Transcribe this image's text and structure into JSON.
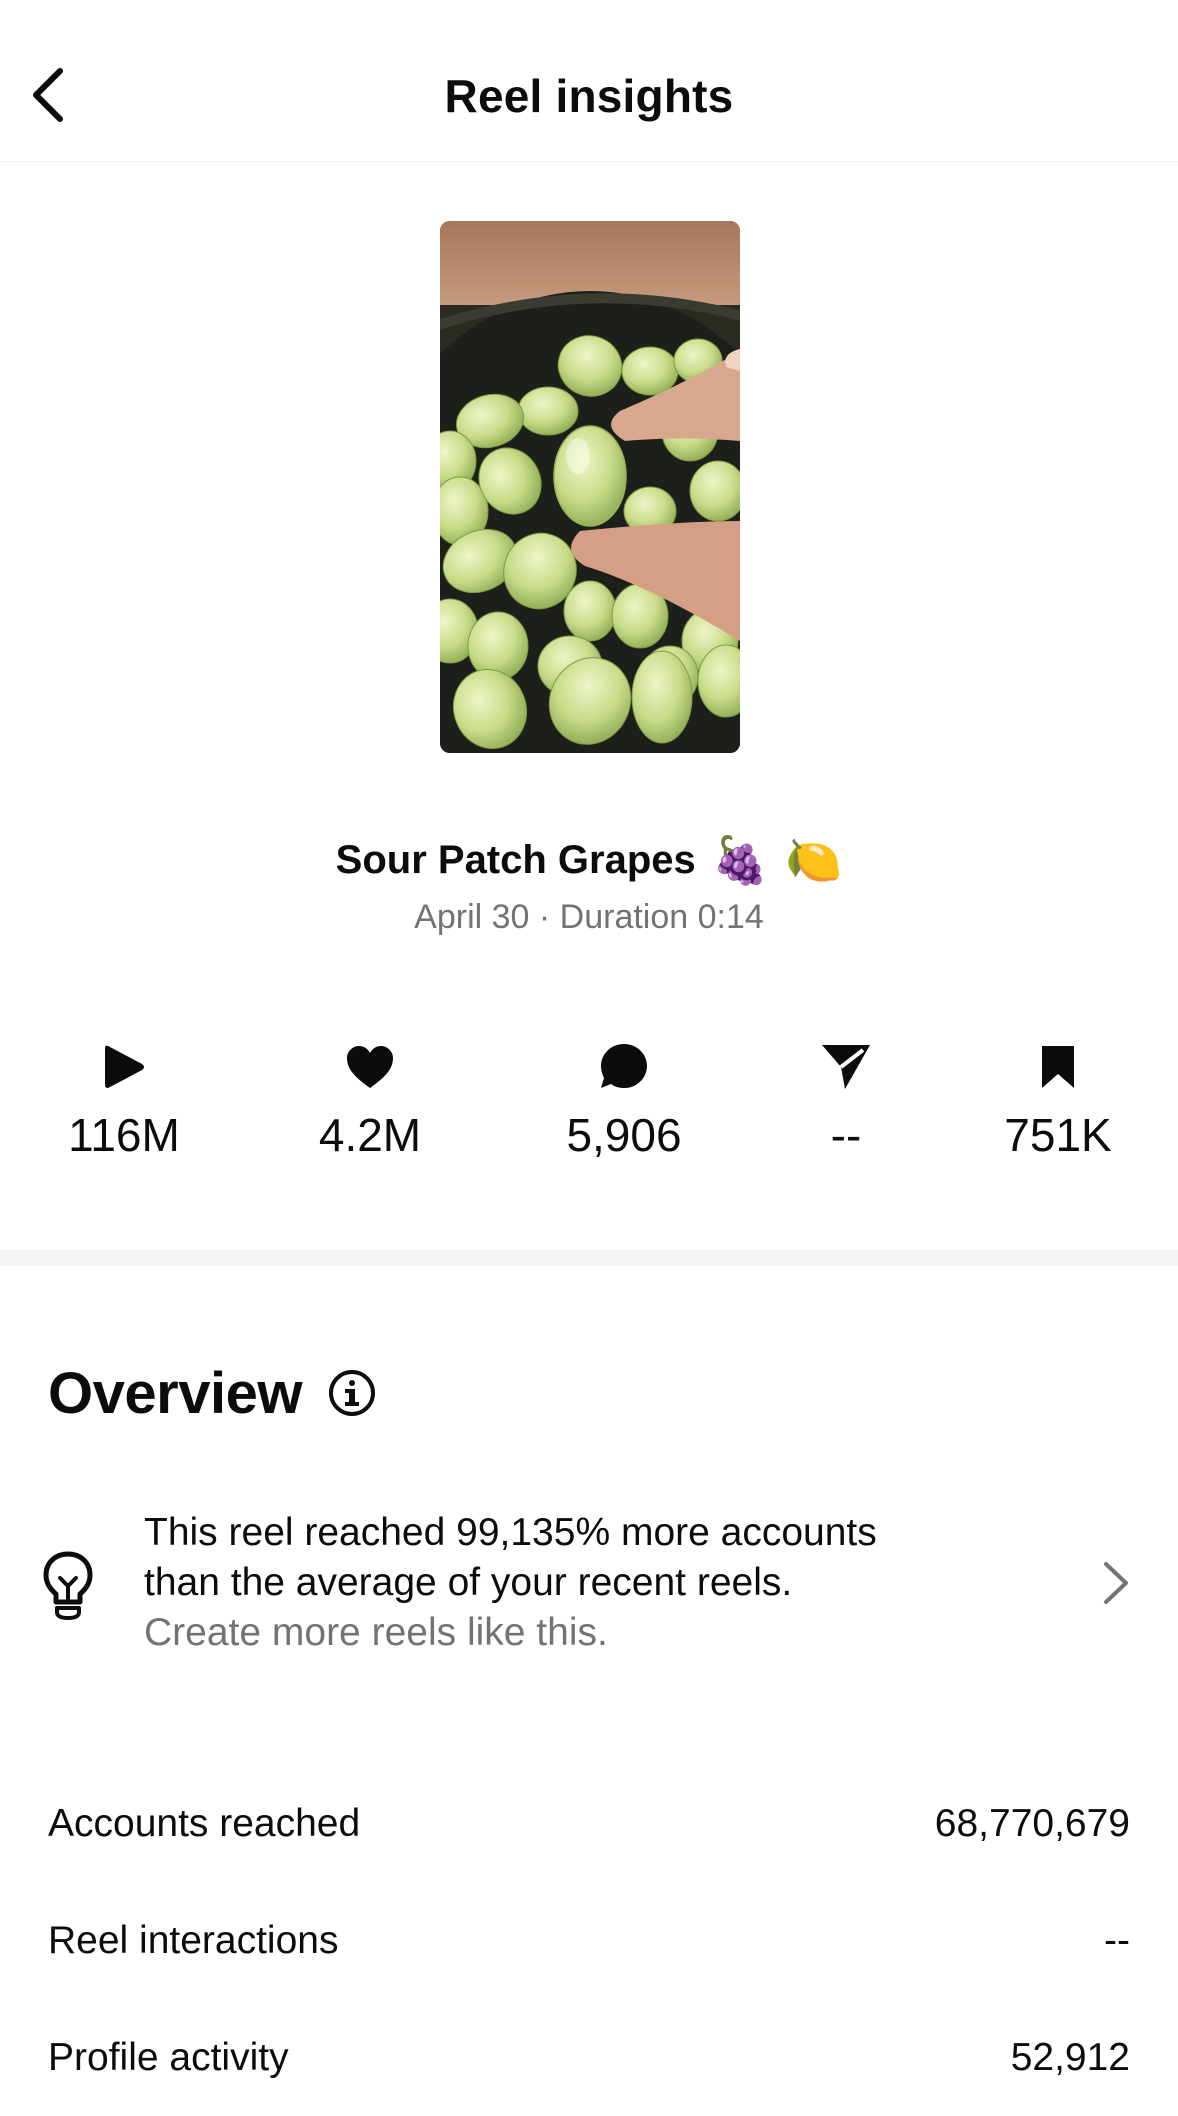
{
  "header": {
    "title": "Reel insights"
  },
  "reel": {
    "title": "Sour Patch Grapes",
    "emoji": [
      "🍇",
      "🍋"
    ],
    "subtitle": "April 30 · Duration 0:14"
  },
  "stats": [
    {
      "icon": "play-icon",
      "value": "116M"
    },
    {
      "icon": "heart-icon",
      "value": "4.2M"
    },
    {
      "icon": "comment-icon",
      "value": "5,906"
    },
    {
      "icon": "share-icon",
      "value": "--"
    },
    {
      "icon": "bookmark-icon",
      "value": "751K"
    }
  ],
  "overview": {
    "title": "Overview",
    "tip": {
      "line1": "This reel reached 99,135% more accounts",
      "line2": "than the average of your recent reels.",
      "line3": "Create more reels like this."
    },
    "rows": [
      {
        "label": "Accounts reached",
        "value": "68,770,679"
      },
      {
        "label": "Reel interactions",
        "value": "--"
      },
      {
        "label": "Profile activity",
        "value": "52,912"
      }
    ]
  }
}
